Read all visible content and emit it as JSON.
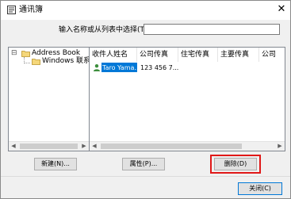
{
  "window": {
    "title": "通讯簿",
    "close_glyph": "✕"
  },
  "search": {
    "label": "输入名称或从列表中选择(T):",
    "value": ""
  },
  "tree": {
    "expander": "⊟",
    "root": "Address Book",
    "child": "Windows 联系人"
  },
  "list": {
    "columns": [
      "收件人姓名",
      "公司传真",
      "住宅传真",
      "主要传真",
      "公司"
    ],
    "rows": [
      {
        "name": "Taro Yama...",
        "company_fax": "123 456 7..."
      }
    ]
  },
  "buttons": {
    "new": "新建(N)...",
    "properties": "属性(P)...",
    "delete": "删除(D)",
    "close": "关闭(C)"
  },
  "colors": {
    "selection": "#0078d7",
    "highlight_box": "#e01818"
  }
}
